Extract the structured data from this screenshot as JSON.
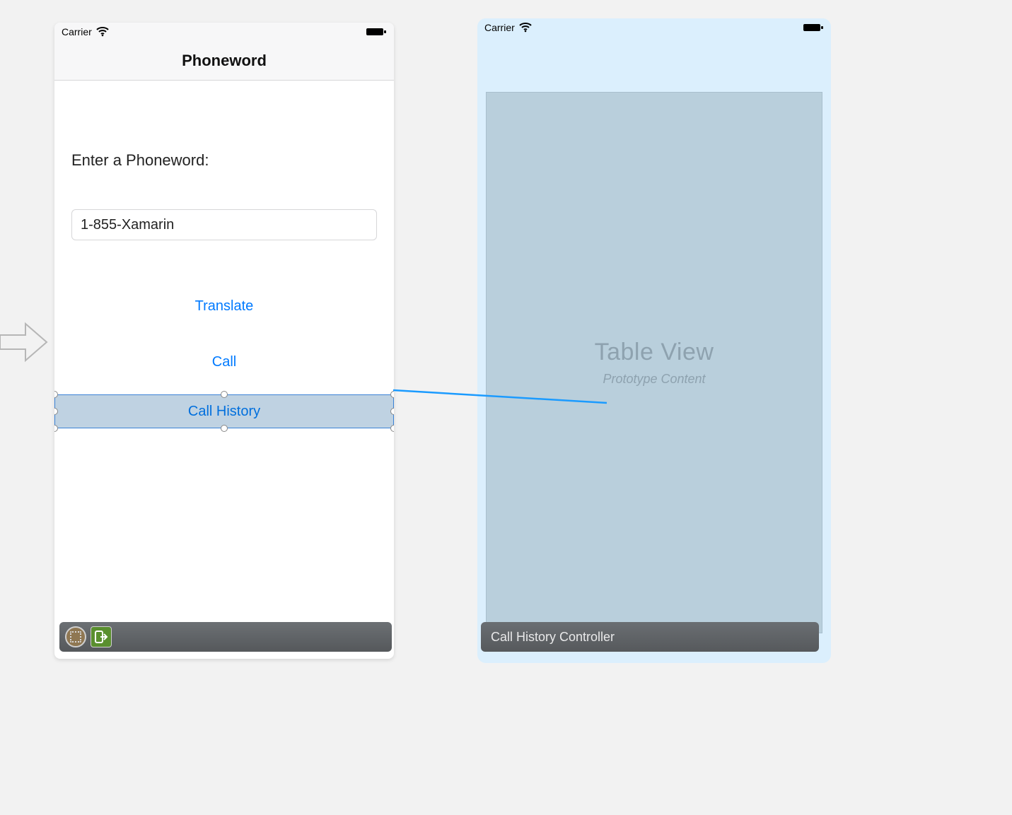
{
  "left_phone": {
    "carrier": "Carrier",
    "nav_title": "Phoneword",
    "prompt": "Enter a Phoneword:",
    "input_value": "1-855-Xamarin",
    "translate_label": "Translate",
    "call_label": "Call",
    "call_history_label": "Call History"
  },
  "right_phone": {
    "carrier": "Carrier",
    "tv_title": "Table View",
    "tv_subtitle": "Prototype Content",
    "scene_label": "Call History Controller"
  },
  "colors": {
    "ios_tint": "#007aff",
    "selection_fill": "#bfd2e2",
    "selection_border": "#3b82d6"
  }
}
